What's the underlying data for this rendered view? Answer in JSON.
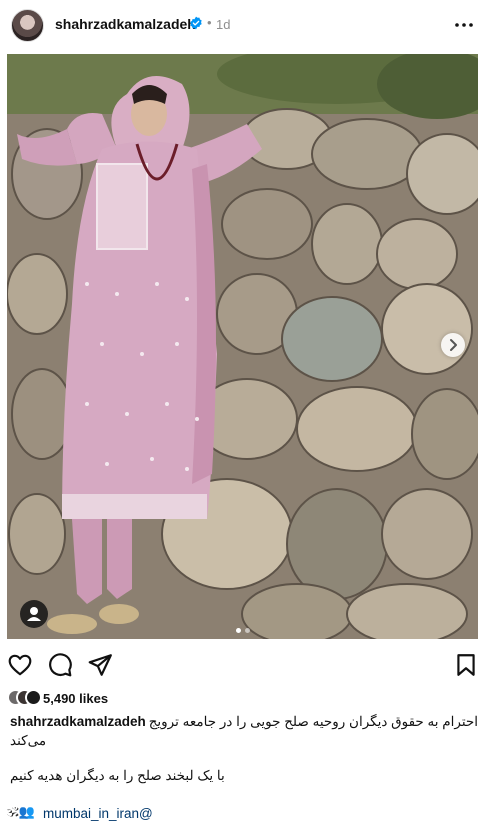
{
  "post": {
    "username": "shahrzadkamalzadeh",
    "separator": "•",
    "time": "1d"
  },
  "likes": {
    "count_text": "5,490 likes"
  },
  "caption": {
    "username": "shahrzadkamalzadeh",
    "line1": "احترام به حقوق دیگران روحیه صلح جویی را در جامعه ترویج",
    "line2": "می‌کند",
    "line3": "با یک لبخند صلح را به دیگران هدیه کنیم",
    "hashtag_prefix": "🕉👥",
    "hashtag": "mumbai_in_iran@"
  },
  "carousel": {
    "count": 2,
    "active": 1
  },
  "icons": {
    "verified": "verified-badge-icon",
    "more": "more-horizontal-icon",
    "like": "heart-icon",
    "comment": "comment-icon",
    "share": "paper-plane-icon",
    "save": "bookmark-icon",
    "next": "chevron-right-icon",
    "tag": "user-tag-icon"
  },
  "colors": {
    "verified": "#0095f6",
    "link": "#00376b",
    "meta": "#8e8e8e"
  }
}
